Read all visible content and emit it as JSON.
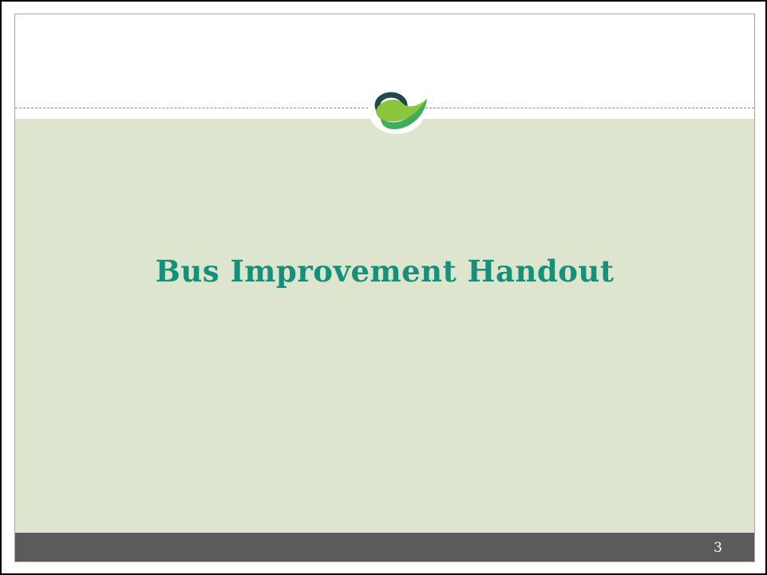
{
  "slide": {
    "title": "Bus Improvement Handout",
    "page_number": "3"
  },
  "logo": {
    "icon": "stylized-leaf-swoosh-logo",
    "colors": {
      "light_green": "#8cc63f",
      "dark_teal": "#1f4a4a",
      "mid_green": "#3fae5a"
    }
  },
  "colors": {
    "title": "#15907a",
    "content_background": "#dee5cf",
    "footer_bar": "#5b5b5b",
    "frame_border": "#000000"
  }
}
